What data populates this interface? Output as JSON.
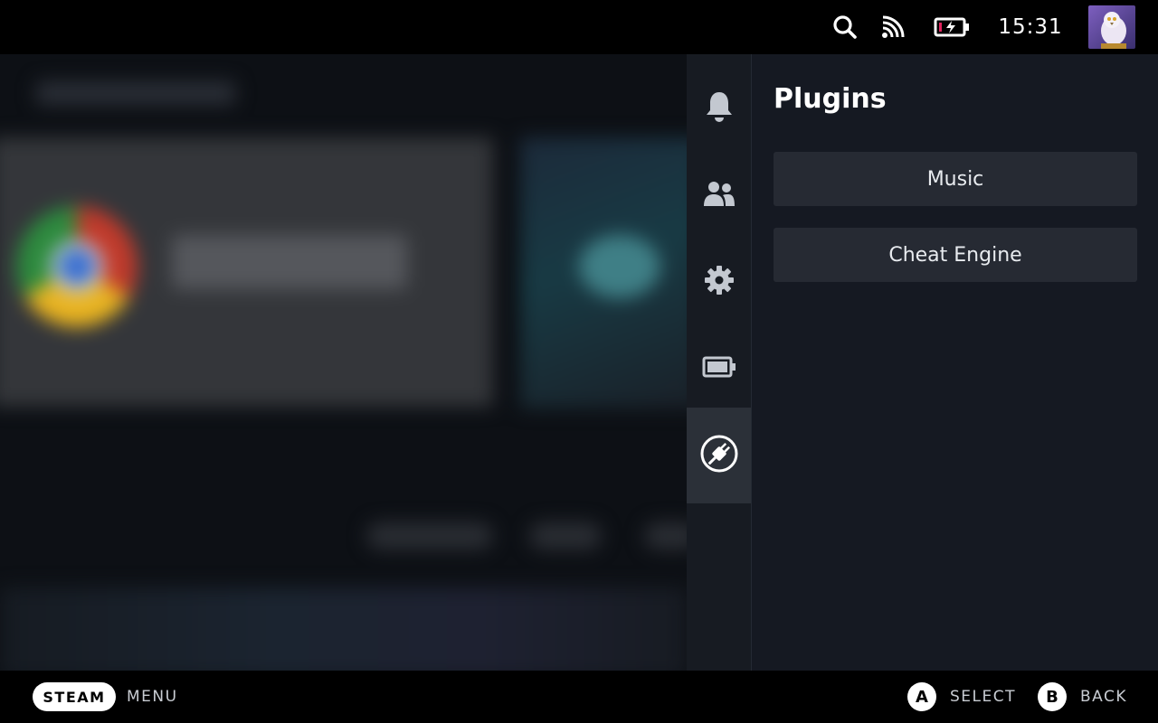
{
  "status_bar": {
    "time": "15:31",
    "icons": [
      "search-icon",
      "cast-icon",
      "battery-charging-icon",
      "avatar"
    ],
    "battery_low_color": "#e0245e"
  },
  "nav_rail": {
    "items": [
      {
        "name": "notifications",
        "icon": "bell-icon"
      },
      {
        "name": "friends",
        "icon": "friends-icon"
      },
      {
        "name": "settings",
        "icon": "gear-icon"
      },
      {
        "name": "performance",
        "icon": "battery-icon"
      },
      {
        "name": "plugins",
        "icon": "plug-icon",
        "active": true
      }
    ]
  },
  "plugins_panel": {
    "title": "Plugins",
    "items": [
      {
        "label": "Music"
      },
      {
        "label": "Cheat Engine"
      }
    ]
  },
  "bottom_bar": {
    "steam_label": "STEAM",
    "menu_label": "MENU",
    "a_glyph": "A",
    "select_label": "SELECT",
    "b_glyph": "B",
    "back_label": "BACK"
  },
  "colors": {
    "bar_bg": "#000000",
    "panel_bg": "#151922",
    "rail_bg": "#171b22",
    "rail_active": "#2b3038",
    "button_bg": "#262a33"
  }
}
